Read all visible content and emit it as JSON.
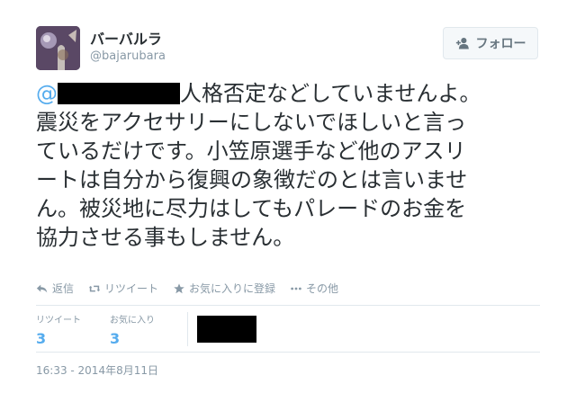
{
  "user": {
    "fullname": "バーバルラ",
    "username": "@bajarubara"
  },
  "follow_button": {
    "label": "フォロー"
  },
  "tweet": {
    "mention_at": "@",
    "text_after_mention": "人格否定などしていませんよ。\n震災をアクセサリーにしないでほしいと言っ\nているだけです。小笠原選手など他のアスリ\nートは自分から復興の象徴だのとは言いませ\nん。被災地に尽力はしてもパレードのお金を\n協力させる事もしません。"
  },
  "actions": {
    "reply": "返信",
    "retweet": "リツイート",
    "favorite": "お気に入りに登録",
    "more": "その他"
  },
  "stats": {
    "retweets_label": "リツイート",
    "retweets_count": "3",
    "favorites_label": "お気に入り",
    "favorites_count": "3"
  },
  "timestamp": "16:33 - 2014年8月11日",
  "colors": {
    "link": "#55acee",
    "muted": "#8899a6",
    "text": "#292f33",
    "redaction": "#000000"
  },
  "icons": [
    "avatar-image",
    "follow-person-icon",
    "reply-icon",
    "retweet-icon",
    "star-icon",
    "more-dots-icon"
  ]
}
